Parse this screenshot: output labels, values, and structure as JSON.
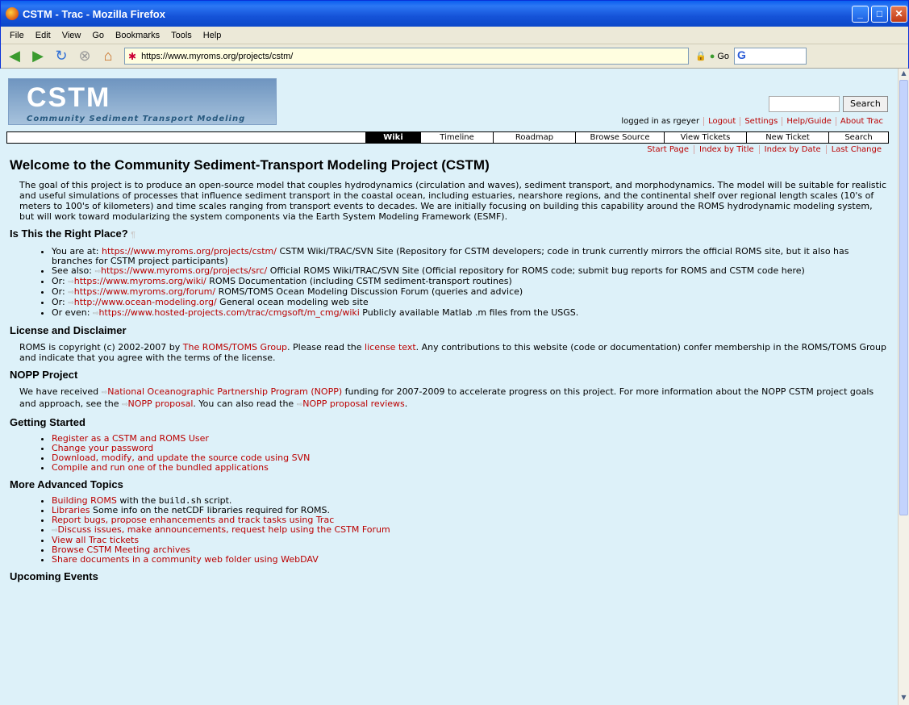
{
  "window": {
    "title": "CSTM - Trac - Mozilla Firefox"
  },
  "menu": [
    "File",
    "Edit",
    "View",
    "Go",
    "Bookmarks",
    "Tools",
    "Help"
  ],
  "toolbar": {
    "url": "https://www.myroms.org/projects/cstm/",
    "go_label": "Go",
    "search_engine": "G"
  },
  "logo": {
    "big": "CSTM",
    "small": "Community Sediment Transport Modeling"
  },
  "search": {
    "button": "Search"
  },
  "metanav": [
    "logged in as rgeyer",
    "Logout",
    "Settings",
    "Help/Guide",
    "About Trac"
  ],
  "mainnav": [
    "Wiki",
    "Timeline",
    "Roadmap",
    "Browse Source",
    "View Tickets",
    "New Ticket",
    "Search"
  ],
  "ctxtnav": [
    "Start Page",
    "Index by Title",
    "Index by Date",
    "Last Change"
  ],
  "page": {
    "title": "Welcome to the Community Sediment-Transport Modeling Project (CSTM)",
    "intro": "The goal of this project is to produce an open-source model that couples hydrodynamics (circulation and waves), sediment transport, and morphodynamics. The model will be suitable for realistic and useful simulations of processes that influence sediment transport in the coastal ocean, including estuaries, nearshore regions, and the continental shelf over regional length scales (10's of meters to 100's of kilometers) and time scales ranging from transport events to decades. We are initially focusing on building this capability around the ROMS hydrodynamic modeling system, but will work toward modularizing the system components via the Earth System Modeling Framework (ESMF).",
    "s1_title": "Is This the Right Place?",
    "s1_pilcrow": "¶",
    "s1_items": [
      {
        "pre": "You are at: ",
        "link": "https://www.myroms.org/projects/cstm/",
        "post": " CSTM Wiki/TRAC/SVN Site (Repository for CSTM developers; code in trunk currently mirrors the official ROMS site, but it also has branches for CSTM project participants)"
      },
      {
        "pre": "See also: ",
        "link": "https://www.myroms.org/projects/src/",
        "post": " Official ROMS Wiki/TRAC/SVN Site (Official repository for ROMS code; submit bug reports for ROMS and CSTM code here)"
      },
      {
        "pre": "Or: ",
        "link": "https://www.myroms.org/wiki/",
        "post": " ROMS Documentation (including CSTM sediment-transport routines)"
      },
      {
        "pre": "Or: ",
        "link": "https://www.myroms.org/forum/",
        "post": " ROMS/TOMS Ocean Modeling Discussion Forum (queries and advice)"
      },
      {
        "pre": "Or: ",
        "link": "http://www.ocean-modeling.org/",
        "post": " General ocean modeling web site"
      },
      {
        "pre": "Or even: ",
        "link": "https://www.hosted-projects.com/trac/cmgsoft/m_cmg/wiki",
        "post": " Publicly available Matlab .m files from the USGS."
      }
    ],
    "s2_title": "License and Disclaimer",
    "s2_a": "ROMS is copyright (c) 2002-2007 by ",
    "s2_link1": "The ROMS/TOMS Group",
    "s2_b": ". Please read the ",
    "s2_link2": "license text",
    "s2_c": ". Any contributions to this website (code or documentation) confer membership in the ROMS/TOMS Group and indicate that you agree with the terms of the license.",
    "s3_title": "NOPP Project",
    "s3_a": "We have received ",
    "s3_link1": "National Oceanographic Partnership Program (NOPP)",
    "s3_b": " funding for 2007-2009 to accelerate progress on this project. For more information about the NOPP CSTM project goals and approach, see the ",
    "s3_link2": "NOPP proposal",
    "s3_c": ". You can also read the ",
    "s3_link3": "NOPP proposal reviews",
    "s3_d": ".",
    "s4_title": "Getting Started",
    "s4_items": [
      "Register as a CSTM and ROMS User",
      "Change your password",
      "Download, modify, and update the source code using SVN",
      "Compile and run one of the bundled applications"
    ],
    "s5_title": "More Advanced Topics",
    "s5_i1_link": "Building ROMS",
    "s5_i1_a": " with the ",
    "s5_i1_code": "build.sh",
    "s5_i1_b": " script.",
    "s5_i2_link": "Libraries",
    "s5_i2_text": " Some info on the netCDF libraries required for ROMS.",
    "s5_items": [
      "Report bugs, propose enhancements and track tasks using Trac",
      "Discuss issues, make announcements, request help using the CSTM Forum",
      "View all Trac tickets",
      "Browse CSTM Meeting archives",
      "Share documents in a community web folder using WebDAV"
    ],
    "s6_title": "Upcoming Events"
  }
}
